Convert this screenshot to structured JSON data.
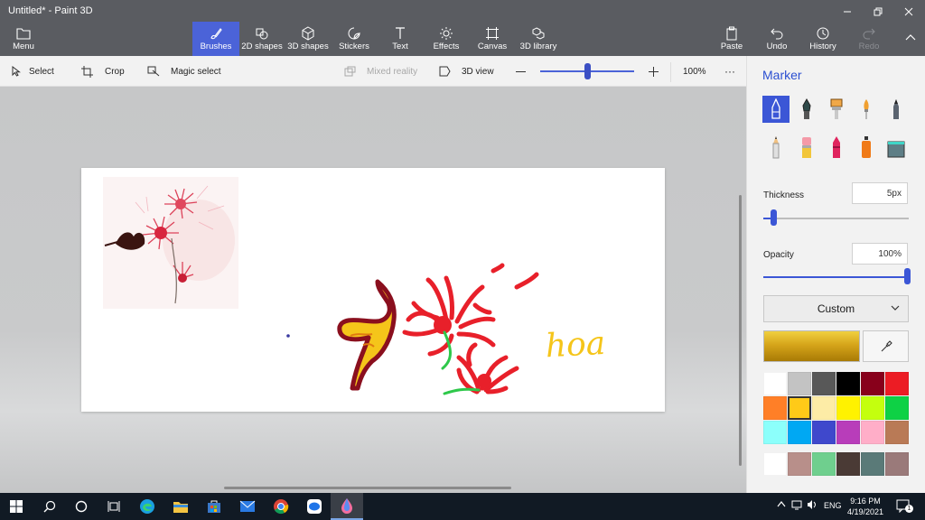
{
  "window": {
    "title": "Untitled* - Paint 3D",
    "minimize_icon": "minimize-icon",
    "maximize_icon": "restore-icon",
    "close_icon": "close-icon"
  },
  "ribbon": {
    "menu_label": "Menu",
    "items": [
      {
        "label": "Brushes",
        "icon": "brush-icon",
        "active": true
      },
      {
        "label": "2D shapes",
        "icon": "2d-shapes-icon"
      },
      {
        "label": "3D shapes",
        "icon": "3d-shapes-icon"
      },
      {
        "label": "Stickers",
        "icon": "sticker-icon"
      },
      {
        "label": "Text",
        "icon": "text-icon"
      },
      {
        "label": "Effects",
        "icon": "effects-icon"
      },
      {
        "label": "Canvas",
        "icon": "canvas-icon"
      },
      {
        "label": "3D library",
        "icon": "3d-library-icon"
      }
    ],
    "paste_label": "Paste",
    "undo_label": "Undo",
    "history_label": "History",
    "redo_label": "Redo"
  },
  "toolbar": {
    "select_label": "Select",
    "crop_label": "Crop",
    "magic_select_label": "Magic select",
    "mixed_reality_label": "Mixed reality",
    "view3d_label": "3D view",
    "zoom_level": "100%",
    "zoom_fraction": 0.5,
    "more_label": "···"
  },
  "panel": {
    "title": "Marker",
    "brushes": [
      {
        "name": "marker-icon",
        "selected": true
      },
      {
        "name": "calligraphy-pen-icon"
      },
      {
        "name": "oil-brush-icon"
      },
      {
        "name": "watercolor-icon"
      },
      {
        "name": "pixel-pen-icon"
      },
      {
        "name": "pencil-icon"
      },
      {
        "name": "eraser-icon"
      },
      {
        "name": "crayon-icon"
      },
      {
        "name": "spraycan-icon"
      },
      {
        "name": "fill-icon"
      }
    ],
    "thickness_label": "Thickness",
    "thickness_value": "5px",
    "thickness_fraction": 0.05,
    "opacity_label": "Opacity",
    "opacity_value": "100%",
    "opacity_fraction": 1.0,
    "color_mode": "Custom",
    "current_color": "#d6a51a",
    "palette": [
      "#ffffff",
      "#c3c3c3",
      "#585858",
      "#000000",
      "#88001b",
      "#ec1c24",
      "#ff7f27",
      "#ffca18",
      "#fdeca6",
      "#fff200",
      "#c4ff0e",
      "#0ed145",
      "#8cfffb",
      "#00a8f3",
      "#3f48cc",
      "#b83dba",
      "#ffaec8",
      "#b97a56"
    ],
    "custom_palette": [
      "#ffffff",
      "#b88f8a",
      "#6fcf8e",
      "#4a3a35",
      "#5a7a78",
      "#9a7a7a"
    ],
    "selected_swatch": 7
  },
  "canvas": {
    "sketch_word": "hoa"
  },
  "taskbar": {
    "apps": [
      "start-icon",
      "search-icon",
      "cortana-icon",
      "task-view-icon",
      "edge-icon",
      "file-explorer-icon",
      "store-icon",
      "mail-icon",
      "chrome-icon",
      "zalo-icon",
      "paint3d-icon"
    ],
    "language": "ENG",
    "time": "9:16 PM",
    "date": "4/19/2021",
    "notification_count": "1"
  }
}
